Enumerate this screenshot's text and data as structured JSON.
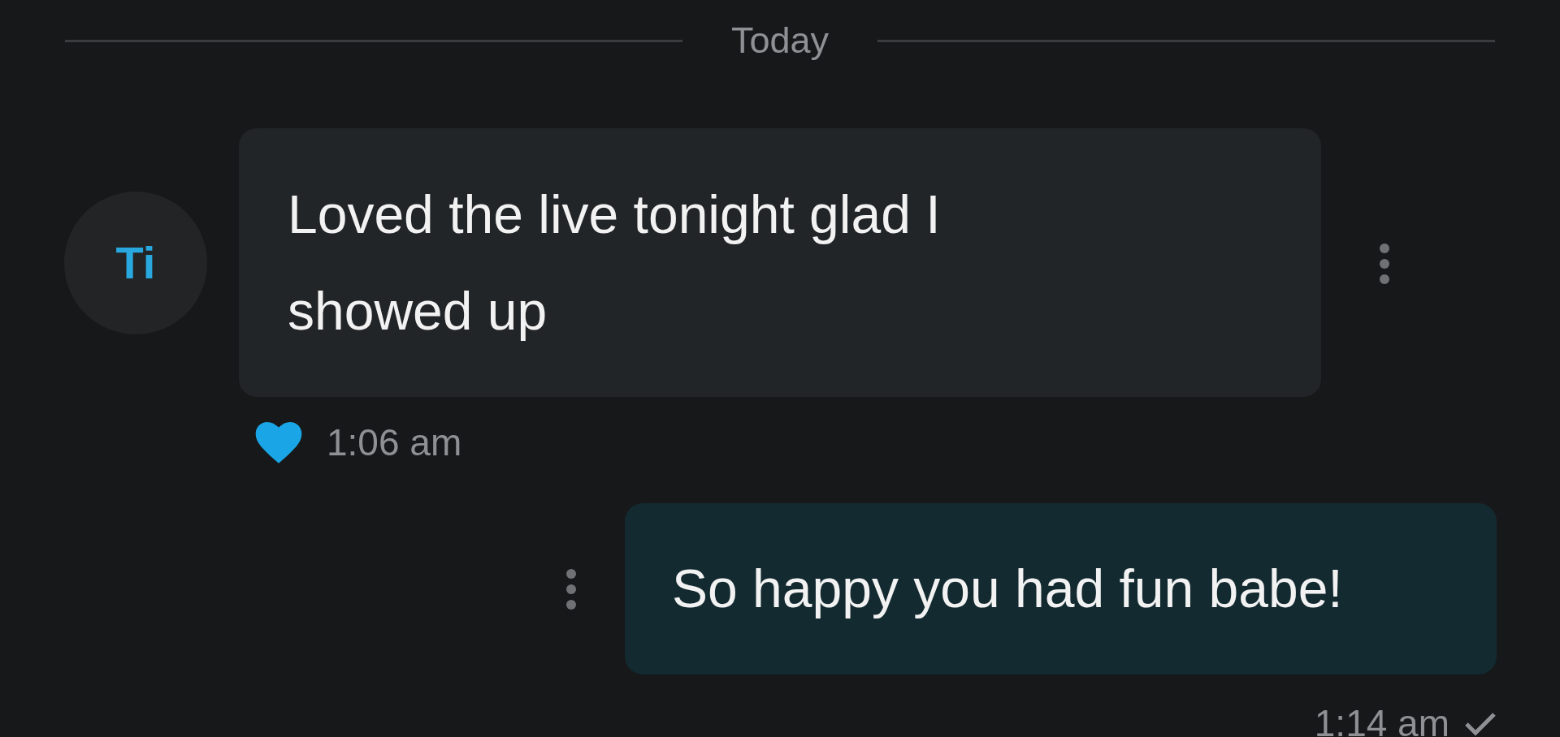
{
  "date_divider": "Today",
  "messages": [
    {
      "kind": "incoming",
      "avatar": "Ti",
      "text": "Loved the live tonight glad I showed up",
      "liked": true,
      "time": "1:06 am"
    },
    {
      "kind": "outgoing",
      "text": "So happy you had fun babe!",
      "delivered": true,
      "time": "1:14 am"
    }
  ]
}
